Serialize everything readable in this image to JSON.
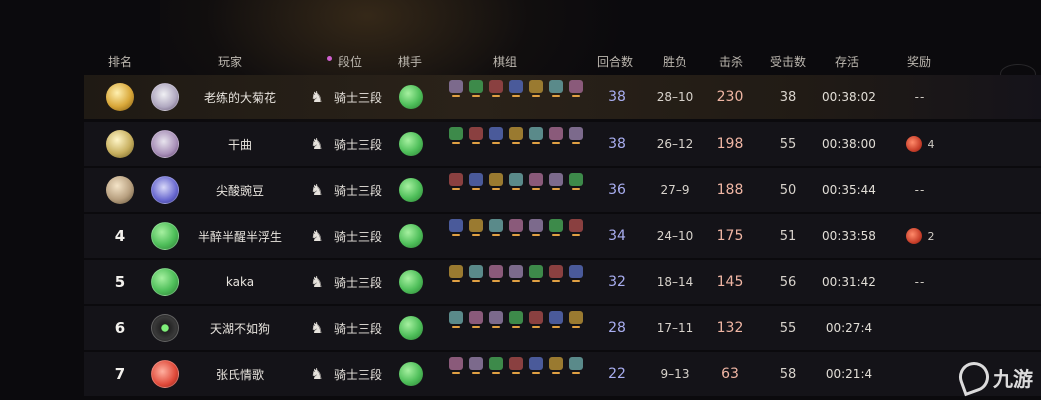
{
  "header": {
    "rank": "排名",
    "player": "玩家",
    "tier": "段位",
    "chess_player": "棋手",
    "lineup": "棋组",
    "rounds": "回合数",
    "win_loss": "胜负",
    "kills": "击杀",
    "damage_taken": "受击数",
    "survival": "存活",
    "reward": "奖励"
  },
  "colors": {
    "accent_rounds": "#a9aef0",
    "accent_kills": "#f0b6a4",
    "top_row": "#2a2219"
  },
  "rows": [
    {
      "rank": "",
      "rank_medal": "gold-medal-icon",
      "avatar": "white-monster-avatar",
      "player": "老练的大菊花",
      "tier": "骑士三段",
      "rounds": "38",
      "win_loss": "28–10",
      "kills": "230",
      "damage": "38",
      "time": "00:38:02",
      "reward": "--",
      "reward_count": ""
    },
    {
      "rank": "",
      "rank_medal": "silver-medal-icon",
      "avatar": "purple-monster-avatar",
      "player": "干曲",
      "tier": "骑士三段",
      "rounds": "38",
      "win_loss": "26–12",
      "kills": "198",
      "damage": "55",
      "time": "00:38:00",
      "reward": "",
      "reward_count": "4"
    },
    {
      "rank": "",
      "rank_medal": "bronze-medal-icon",
      "avatar": "blue-monster-avatar",
      "player": "尖酸豌豆",
      "tier": "骑士三段",
      "rounds": "36",
      "win_loss": "27–9",
      "kills": "188",
      "damage": "50",
      "time": "00:35:44",
      "reward": "--",
      "reward_count": ""
    },
    {
      "rank": "4",
      "rank_medal": "",
      "avatar": "green-ball-avatar",
      "player": "半醉半醒半浮生",
      "tier": "骑士三段",
      "rounds": "34",
      "win_loss": "24–10",
      "kills": "175",
      "damage": "51",
      "time": "00:33:58",
      "reward": "",
      "reward_count": "2"
    },
    {
      "rank": "5",
      "rank_medal": "",
      "avatar": "green-ball-avatar",
      "player": "kaka",
      "tier": "骑士三段",
      "rounds": "32",
      "win_loss": "18–14",
      "kills": "145",
      "damage": "56",
      "time": "00:31:42",
      "reward": "--",
      "reward_count": ""
    },
    {
      "rank": "6",
      "rank_medal": "",
      "avatar": "dark-orb-avatar",
      "player": "天湖不如狗",
      "tier": "骑士三段",
      "rounds": "28",
      "win_loss": "17–11",
      "kills": "132",
      "damage": "55",
      "time": "00:27:4",
      "reward": "",
      "reward_count": ""
    },
    {
      "rank": "7",
      "rank_medal": "",
      "avatar": "red-bird-avatar",
      "player": "张氏情歌",
      "tier": "骑士三段",
      "rounds": "22",
      "win_loss": "9–13",
      "kills": "63",
      "damage": "58",
      "time": "00:21:4",
      "reward": "",
      "reward_count": ""
    }
  ],
  "watermark": {
    "text": "九游"
  }
}
